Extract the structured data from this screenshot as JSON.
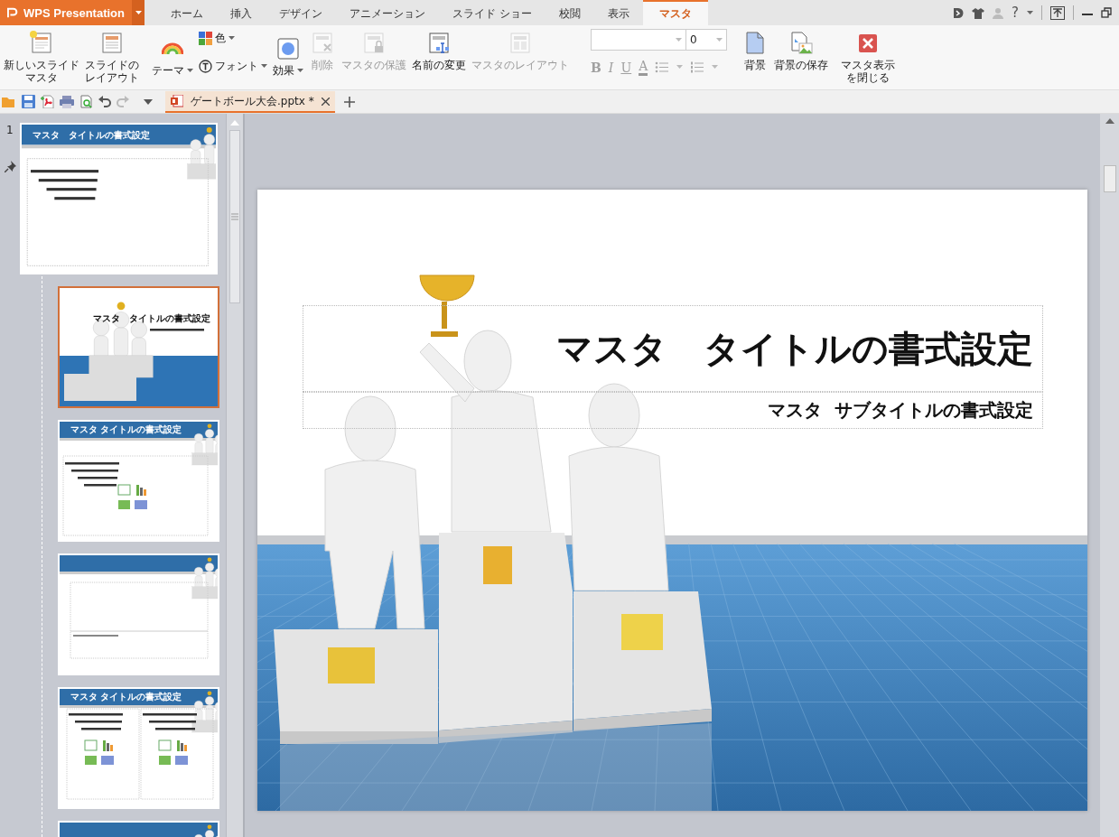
{
  "app": {
    "label": "WPS Presentation"
  },
  "menu_tabs": [
    {
      "label": "ホーム",
      "selected": false
    },
    {
      "label": "挿入",
      "selected": false
    },
    {
      "label": "デザイン",
      "selected": false
    },
    {
      "label": "アニメーション",
      "selected": false
    },
    {
      "label": "スライド ショー",
      "selected": false
    },
    {
      "label": "校閲",
      "selected": false
    },
    {
      "label": "表示",
      "selected": false
    },
    {
      "label": "マスタ",
      "selected": true
    }
  ],
  "help": "?",
  "ribbon": [
    {
      "kind": "large",
      "label": "新しいスライドマスタ",
      "disabled": false
    },
    {
      "kind": "large",
      "label": "スライドのレイアウト",
      "disabled": false
    },
    {
      "kind": "dropdown",
      "label": "テーマ",
      "disabled": false
    },
    {
      "kind": "pair",
      "items": [
        {
          "label": "色"
        },
        {
          "label": "フォント"
        }
      ]
    },
    {
      "kind": "dropdown",
      "label": "効果",
      "disabled": false
    },
    {
      "kind": "large",
      "label": "削除",
      "disabled": true
    },
    {
      "kind": "large",
      "label": "マスタの保護",
      "disabled": true
    },
    {
      "kind": "large",
      "label": "名前の変更",
      "disabled": false
    },
    {
      "kind": "large",
      "label": "マスタのレイアウト",
      "disabled": true
    },
    {
      "kind": "font",
      "size": "0",
      "format_buttons": [
        "B",
        "I",
        "U",
        "A"
      ],
      "disabled": true
    },
    {
      "kind": "large",
      "label": "背景",
      "disabled": false
    },
    {
      "kind": "large",
      "label": "背景の保存",
      "disabled": false
    },
    {
      "kind": "large",
      "label": "マスタ表示を閉じる",
      "disabled": false
    }
  ],
  "document_tab": {
    "label": "ゲートボール大会.pptx *",
    "selected": true
  },
  "thumbnails": [
    {
      "kind": "master",
      "number": "1",
      "title": "マスタ　タイトルの書式設定",
      "selected": false
    },
    {
      "kind": "title",
      "title": "マスタ　タイトルの書式設定",
      "selected": true
    },
    {
      "kind": "content",
      "title": "マスタ タイトルの書式設定",
      "selected": false
    },
    {
      "kind": "section",
      "selected": false
    },
    {
      "kind": "two-content",
      "title": "マスタ タイトルの書式設定",
      "selected": false
    },
    {
      "kind": "partial",
      "selected": false
    }
  ],
  "slide": {
    "title": "マスタ　タイトルの書式設定",
    "subtitle": "マスタ  サブタイトルの書式設定"
  }
}
